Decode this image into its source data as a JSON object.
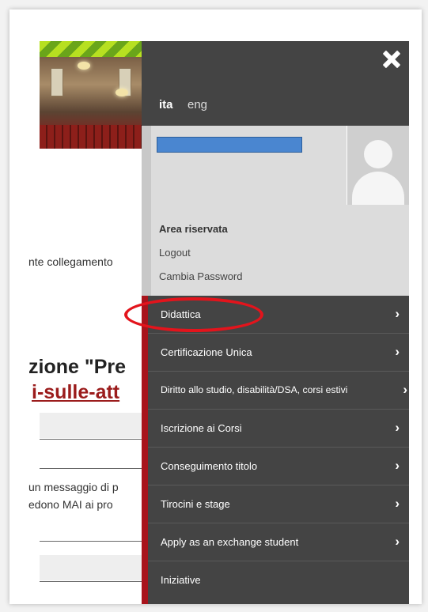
{
  "background_page": {
    "partial_text_link_note": "nte collegamento",
    "heading_partial": "zione \"Pre",
    "link_partial": "i-sulle-att",
    "message_line1": "un messaggio di p",
    "message_line2": "edono MAI ai pro"
  },
  "menu": {
    "close_label": "✖",
    "languages": {
      "active": "ita",
      "other": "eng"
    },
    "user": {
      "area_title": "Area riservata",
      "logout": "Logout",
      "change_password": "Cambia Password"
    },
    "items": [
      {
        "label": "Didattica",
        "arrow": "›"
      },
      {
        "label": "Certificazione Unica",
        "arrow": "›"
      },
      {
        "label": "Diritto allo studio, disabilità/DSA, corsi estivi",
        "arrow": "›"
      },
      {
        "label": "Iscrizione ai Corsi",
        "arrow": "›"
      },
      {
        "label": "Conseguimento titolo",
        "arrow": "›"
      },
      {
        "label": "Tirocini e stage",
        "arrow": "›"
      },
      {
        "label": "Apply as an exchange student",
        "arrow": "›"
      },
      {
        "label": "Iniziative",
        "arrow": ""
      }
    ]
  },
  "colors": {
    "menu_bg": "#444444",
    "accent_red": "#a8141c",
    "highlight_red": "#e3141c",
    "redacted_blue": "#4a86d0"
  }
}
